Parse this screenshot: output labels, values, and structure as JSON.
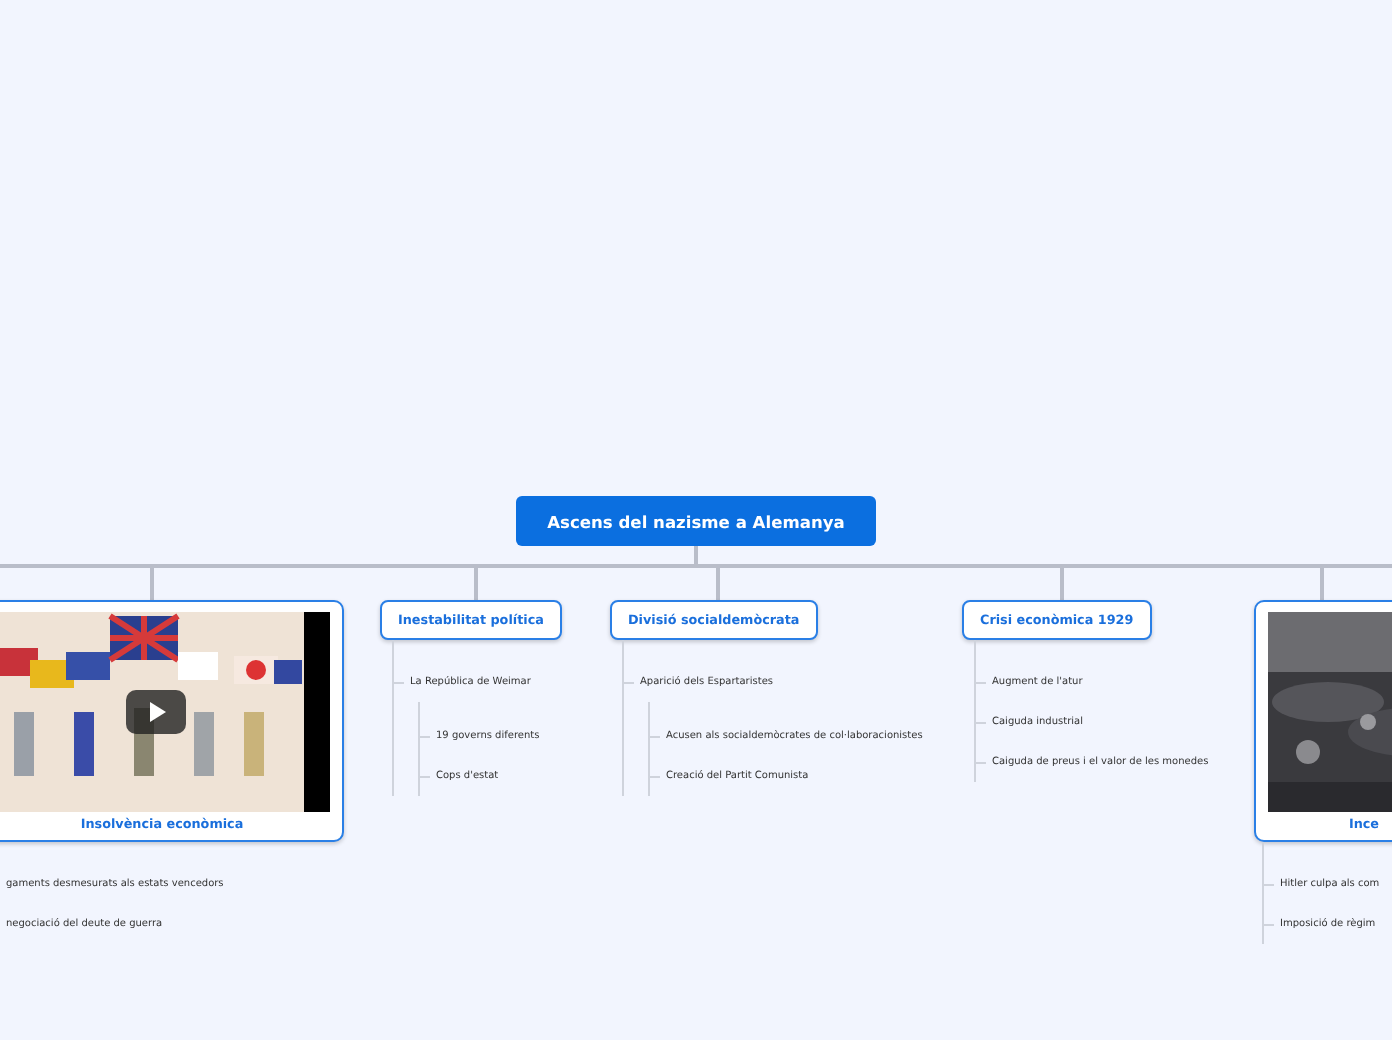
{
  "root": {
    "title": "Ascens del nazisme a Alemanya"
  },
  "topics": [
    {
      "kind": "picture",
      "caption": "Insolvència econòmica",
      "video": true,
      "children": [
        {
          "text": "gaments desmesurats als estats vencedors"
        },
        {
          "text": "negociació del deute de guerra"
        }
      ]
    },
    {
      "kind": "label",
      "title": "Inestabilitat política",
      "children": [
        {
          "text": "La República de Weimar",
          "children": [
            {
              "text": "19 governs diferents"
            },
            {
              "text": "Cops d'estat"
            }
          ]
        }
      ]
    },
    {
      "kind": "label",
      "title": "Divisió socialdemòcrata",
      "children": [
        {
          "text": "Aparició dels Espartaristes",
          "children": [
            {
              "text": "Acusen als socialdemòcrates de col·laboracionistes"
            },
            {
              "text": "Creació del Partit Comunista"
            }
          ]
        }
      ]
    },
    {
      "kind": "label",
      "title": "Crisi econòmica 1929",
      "children": [
        {
          "text": "Augment de l'atur"
        },
        {
          "text": "Caiguda industrial"
        },
        {
          "text": "Caiguda de preus i el valor de les monedes"
        }
      ]
    },
    {
      "kind": "picture",
      "caption": "Ince",
      "video": false,
      "children": [
        {
          "text": "Hitler culpa als com"
        },
        {
          "text": "Imposició de règim"
        }
      ]
    }
  ]
}
